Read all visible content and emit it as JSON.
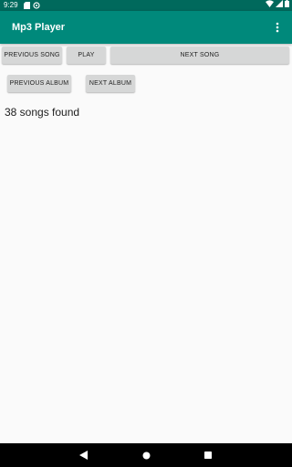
{
  "status_bar": {
    "time": "9:29",
    "icons": [
      "sd-card-icon",
      "sync-icon",
      "wifi-icon",
      "signal-icon",
      "battery-icon"
    ]
  },
  "app_bar": {
    "title": "Mp3 Player",
    "menu_icon": "more-vert-icon"
  },
  "controls": {
    "previous_song": "PREVIOUS SONG",
    "play": "PLAY",
    "next_song": "NEXT SONG",
    "previous_album": "PREVIOUS ALBUM",
    "next_album": "NEXT ALBUM"
  },
  "library": {
    "songs_found": "38 songs found"
  },
  "nav_bar": {
    "icons": [
      "back-icon",
      "home-icon",
      "recents-icon"
    ]
  },
  "colors": {
    "status_bar": "#00695c",
    "app_bar": "#00897b",
    "button": "#d6d7d7",
    "background": "#fafafa"
  }
}
